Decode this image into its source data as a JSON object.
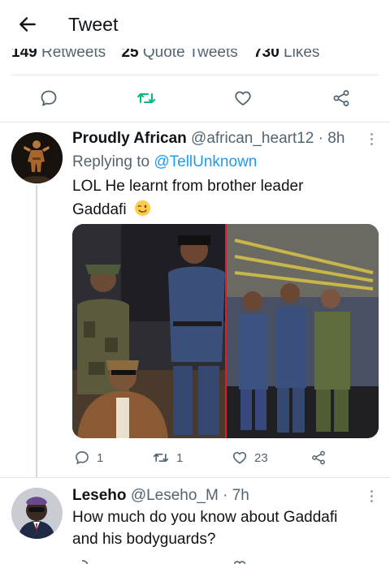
{
  "header": {
    "title": "Tweet"
  },
  "stats": {
    "retweets_count": "149",
    "retweets_label": "Retweets",
    "quotes_count": "25",
    "quotes_label": "Quote Tweets",
    "likes_count": "730",
    "likes_label": "Likes"
  },
  "reply1": {
    "name": "Proudly African",
    "handle": "@african_heart12",
    "sep": "·",
    "time": "8h",
    "replying_prefix": "Replying to",
    "replying_handle": "@TellUnknown",
    "text_line1": "LOL He learnt from brother leader",
    "text_line2": "Gaddafi",
    "emoji": "winking-face-tongue",
    "reply_count": "1",
    "retweet_count": "1",
    "like_count": "23"
  },
  "reply2": {
    "name": "Leseho",
    "handle": "@Leseho_M",
    "sep": "·",
    "time": "7h",
    "text_line1": "How much do you know about Gaddafi",
    "text_line2": "and his bodyguards?"
  },
  "colors": {
    "accent": "#1d9bf0",
    "retweet": "#00ba7c",
    "muted": "#536471",
    "text": "#0f1419"
  },
  "icons": [
    "back-arrow-icon",
    "reply-icon",
    "retweet-icon",
    "like-icon",
    "share-icon",
    "more-icon"
  ]
}
